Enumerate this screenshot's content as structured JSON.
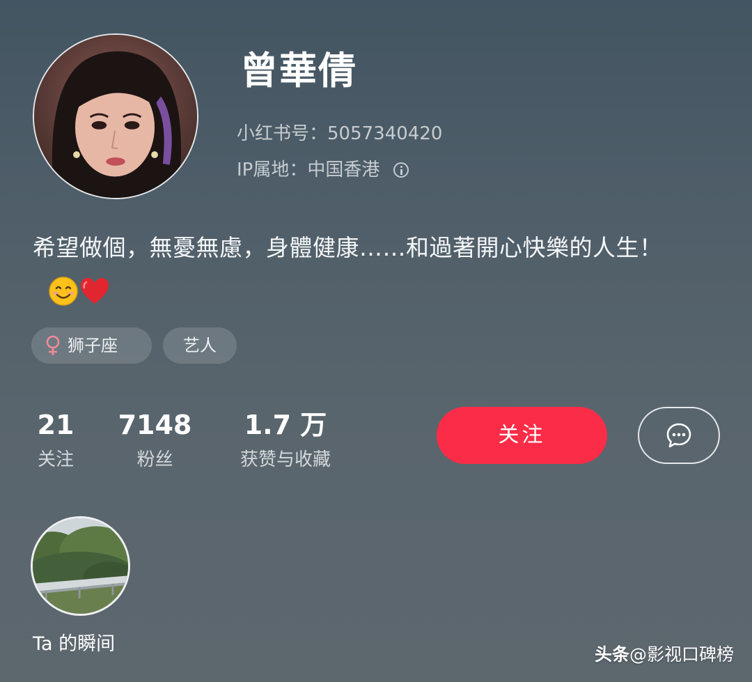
{
  "profile": {
    "name": "曾華倩",
    "id_label": "小红书号：5057340420",
    "ip_label": "IP属地：中国香港",
    "bio_text": "希望做個，無憂無慮，身體健康……和過著開心快樂的人生！",
    "bio_emojis": [
      "smiling-face",
      "red-heart"
    ],
    "avatar_icon": "portrait-photo"
  },
  "tags": [
    {
      "icon": "female-symbol",
      "label": "狮子座",
      "icon_color": "#f08a9a"
    },
    {
      "label": "艺人"
    }
  ],
  "stats": [
    {
      "value": "21",
      "label": "关注"
    },
    {
      "value": "7148",
      "label": "粉丝"
    },
    {
      "value": "1.7 万",
      "label": "获赞与收藏"
    }
  ],
  "actions": {
    "follow_label": "关注",
    "chat_icon": "chat-bubble-icon"
  },
  "moments": {
    "label": "Ta 的瞬间",
    "thumb_icon": "landscape-photo"
  },
  "watermark": {
    "brand": "头条",
    "handle": "@影视口碑榜"
  },
  "colors": {
    "accent": "#fb2c47",
    "background_top": "#435562",
    "background_bottom": "#5d676e"
  }
}
